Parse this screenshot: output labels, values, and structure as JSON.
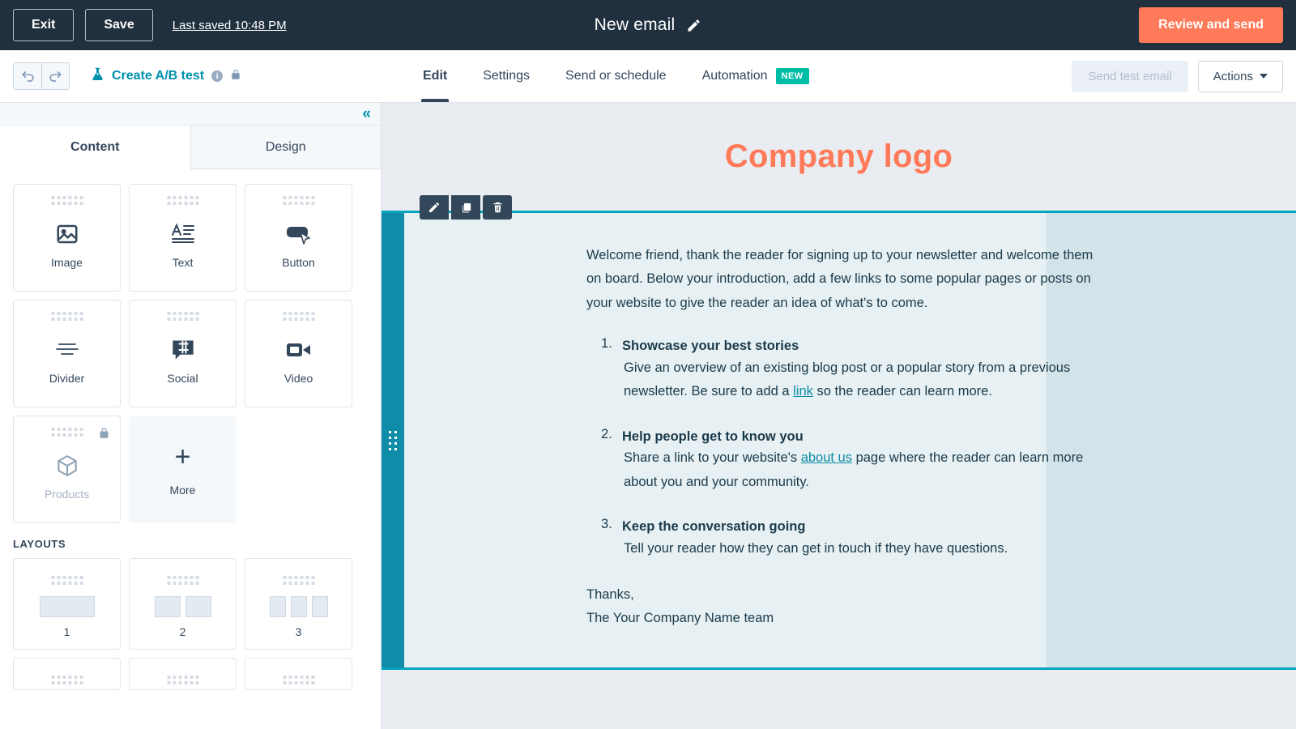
{
  "topbar": {
    "exit_label": "Exit",
    "save_label": "Save",
    "last_saved": "Last saved 10:48 PM",
    "title": "New email",
    "edit_title_icon": "pencil-icon",
    "review_label": "Review and send",
    "accent_orange": "#ff7a59",
    "bg": "#20303f"
  },
  "navbar": {
    "undo_icon": "undo-icon",
    "redo_icon": "redo-icon",
    "ab_test_label": "Create A/B test",
    "ab_test_icon": "flask-icon",
    "info_icon": "info-icon",
    "lock_icon": "lock-icon",
    "tabs": [
      {
        "label": "Edit",
        "active": true,
        "badge": ""
      },
      {
        "label": "Settings",
        "active": false,
        "badge": ""
      },
      {
        "label": "Send or schedule",
        "active": false,
        "badge": ""
      },
      {
        "label": "Automation",
        "active": false,
        "badge": "NEW"
      }
    ],
    "send_test_label": "Send test email",
    "actions_label": "Actions",
    "badge_color": "#00bda5",
    "link_color": "#0091ae"
  },
  "sidebar": {
    "collapse_icon": "chevron-double-left-icon",
    "tabs": [
      {
        "label": "Content",
        "active": true
      },
      {
        "label": "Design",
        "active": false
      }
    ],
    "modules": [
      {
        "label": "Image",
        "icon": "image-icon",
        "locked": false,
        "kind": "module"
      },
      {
        "label": "Text",
        "icon": "text-icon",
        "locked": false,
        "kind": "module"
      },
      {
        "label": "Button",
        "icon": "button-icon",
        "locked": false,
        "kind": "module"
      },
      {
        "label": "Divider",
        "icon": "divider-icon",
        "locked": false,
        "kind": "module"
      },
      {
        "label": "Social",
        "icon": "social-icon",
        "locked": false,
        "kind": "module"
      },
      {
        "label": "Video",
        "icon": "video-icon",
        "locked": false,
        "kind": "module"
      },
      {
        "label": "Products",
        "icon": "package-icon",
        "locked": true,
        "kind": "module"
      },
      {
        "label": "More",
        "icon": "plus-icon",
        "locked": false,
        "kind": "more"
      }
    ],
    "layouts_heading": "LAYOUTS",
    "layouts": [
      {
        "label": "1",
        "columns": 1
      },
      {
        "label": "2",
        "columns": 2
      },
      {
        "label": "3",
        "columns": 3
      }
    ]
  },
  "canvas": {
    "logo_text": "Company logo",
    "logo_color": "#ff7a59",
    "selection_color": "#00a4bd",
    "drag_rail_color": "#0e8ca8",
    "module_toolbar": [
      {
        "icon": "pencil-icon",
        "name": "edit-module-button"
      },
      {
        "icon": "duplicate-icon",
        "name": "duplicate-module-button"
      },
      {
        "icon": "trash-icon",
        "name": "delete-module-button"
      }
    ],
    "intro_paragraph": "Welcome friend, thank the reader for signing up to your newsletter and welcome them on board. Below your introduction, add a few links to some popular pages or posts on your website to give the reader an idea of what's to come.",
    "list": [
      {
        "heading": "Showcase your best stories",
        "body_before": "Give an overview of an existing blog post or a popular story from a previous newsletter. Be sure to add a ",
        "link": "link",
        "body_after": " so the reader can learn more."
      },
      {
        "heading": "Help people get to know you",
        "body_before": "Share a link to your website's ",
        "link": "about us",
        "body_after": " page where the reader can learn more about you and your community."
      },
      {
        "heading": "Keep the conversation going",
        "body_before": "Tell your reader how they can get in touch if they have questions.",
        "link": "",
        "body_after": ""
      }
    ],
    "closing_line_1": "Thanks,",
    "closing_line_2": "The Your Company Name team",
    "below_dots": "· · ·"
  }
}
